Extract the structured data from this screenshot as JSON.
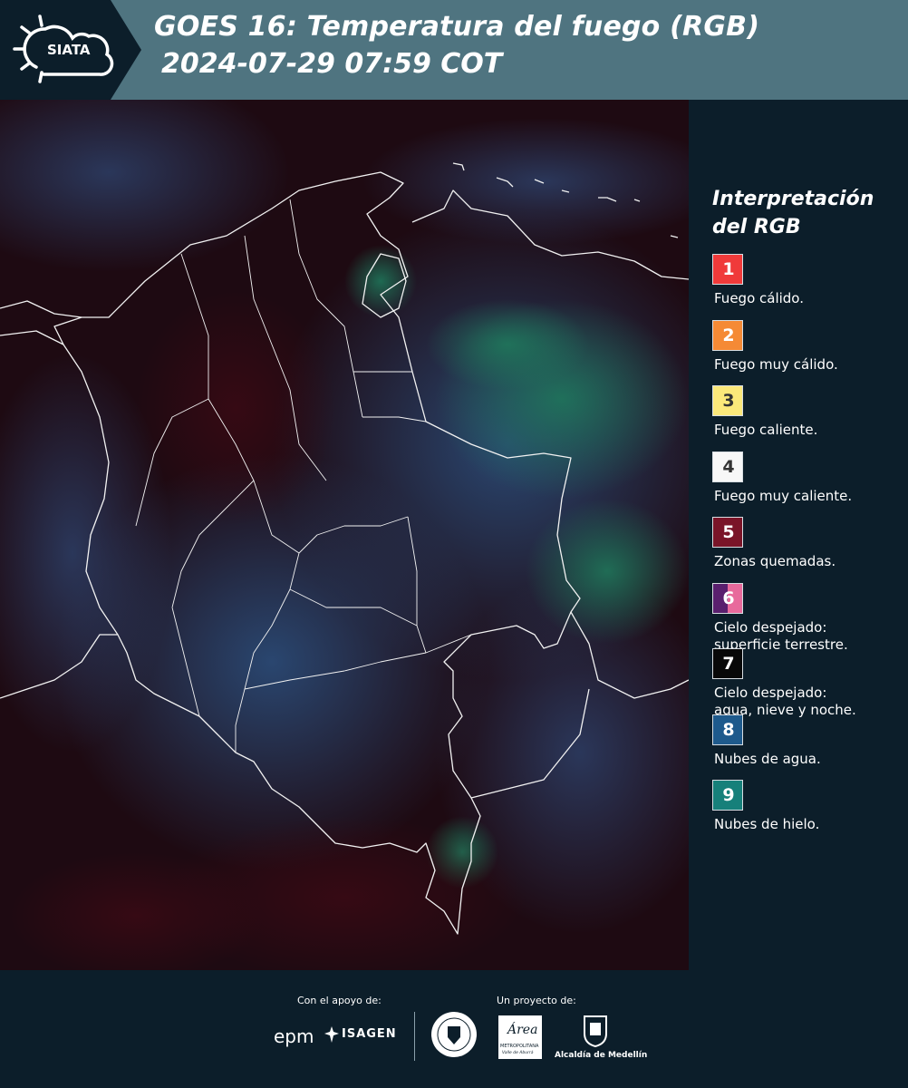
{
  "header": {
    "brand": "SIATA",
    "title_line1": "GOES 16: Temperatura del fuego (RGB)",
    "title_line2": "2024-07-29 07:59 COT",
    "colors": {
      "dark": "#0c1e2a",
      "band": "#4f7480"
    }
  },
  "legend": {
    "title": "Interpretación del RGB",
    "items": [
      {
        "num": "1",
        "label": "Fuego cálido.",
        "color": "#f03a3a"
      },
      {
        "num": "2",
        "label": "Fuego muy cálido.",
        "color": "#f58a35"
      },
      {
        "num": "3",
        "label": "Fuego caliente.",
        "color": "#fbe87a"
      },
      {
        "num": "4",
        "label": "Fuego muy caliente.",
        "color": "#f7f7f7"
      },
      {
        "num": "5",
        "label": "Zonas quemadas.",
        "color": "#7a1428"
      },
      {
        "num": "6",
        "label": "Cielo despejado:\nsuperficie terrestre.",
        "color": "#5a1f6e",
        "color2": "#e86a9c"
      },
      {
        "num": "7",
        "label": "Cielo despejado:\nagua, nieve y noche.",
        "color": "#080808"
      },
      {
        "num": "8",
        "label": "Nubes de agua.",
        "color": "#1e5a8c"
      },
      {
        "num": "9",
        "label": "Nubes de hielo.",
        "color": "#16807a"
      }
    ]
  },
  "footer": {
    "support_label": "Con el apoyo de:",
    "project_label": "Un proyecto de:",
    "logos": {
      "epm": "epm",
      "isagen": "ISAGEN",
      "area_line1": "Área",
      "area_line2": "METROPOLITANA",
      "area_line3": "Valle de Aburrá",
      "medellin": "Alcaldía de Medellín"
    }
  }
}
